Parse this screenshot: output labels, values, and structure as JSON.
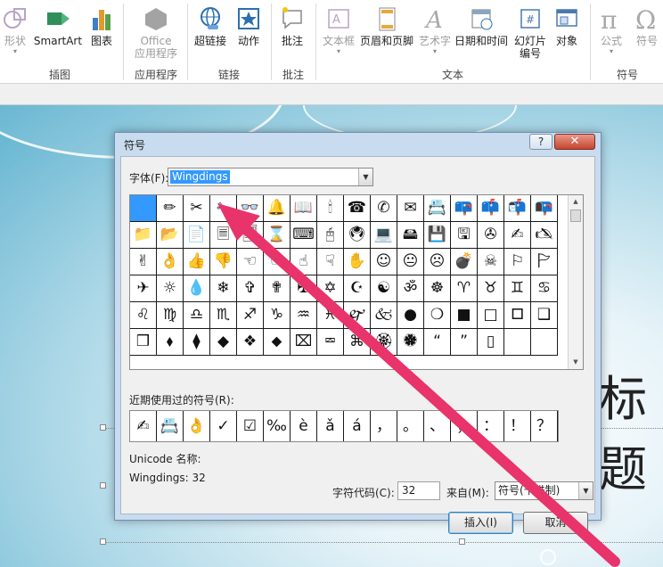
{
  "ribbon": {
    "buttons": [
      {
        "label": "形状",
        "icon": "shapes-icon",
        "disabled": true,
        "dropdown": true
      },
      {
        "label": "SmartArt",
        "icon": "smartart-icon",
        "disabled": false
      },
      {
        "label": "图表",
        "icon": "chart-icon",
        "disabled": false
      },
      {
        "label": "Office",
        "label2": "应用程序",
        "icon": "office-apps-icon",
        "disabled": true,
        "dropdown": true
      },
      {
        "label": "超链接",
        "icon": "hyperlink-icon",
        "disabled": false
      },
      {
        "label": "动作",
        "icon": "action-icon",
        "disabled": false
      },
      {
        "label": "批注",
        "icon": "comment-icon",
        "disabled": false
      },
      {
        "label": "文本框",
        "icon": "textbox-icon",
        "disabled": true,
        "dropdown": true
      },
      {
        "label": "页眉和页脚",
        "icon": "header-footer-icon",
        "disabled": false
      },
      {
        "label": "艺术字",
        "icon": "wordart-icon",
        "disabled": true,
        "dropdown": true
      },
      {
        "label": "日期和时间",
        "icon": "date-time-icon",
        "disabled": false
      },
      {
        "label": "幻灯片",
        "label2": "编号",
        "icon": "slide-number-icon",
        "disabled": false
      },
      {
        "label": "对象",
        "icon": "object-icon",
        "disabled": false
      },
      {
        "label": "公式",
        "icon": "equation-icon",
        "disabled": true,
        "dropdown": true
      },
      {
        "label": "符号",
        "icon": "symbol-icon",
        "disabled": true
      }
    ],
    "groups": [
      "插图",
      "应用程序",
      "链接",
      "批注",
      "文本",
      "符号"
    ]
  },
  "slide": {
    "title_fragment": "标题"
  },
  "dialog": {
    "title": "符号",
    "help": "?",
    "close": "✕",
    "font_label": "字体(F):",
    "font_value": "Wingdings",
    "symbols": [
      [
        "",
        "✏",
        "✂",
        "✁",
        "👓",
        "🔔",
        "📖",
        "🕯",
        "☎",
        "✆",
        "✉",
        "📇",
        "📪",
        "📫",
        "📬",
        "📭"
      ],
      [
        "📁",
        "📂",
        "📄",
        "🗏",
        "🗐",
        "⌛",
        "⌨",
        "🖰",
        "🖲",
        "💻",
        "🖴",
        "💾",
        "🖫",
        "✇",
        "✍",
        "🖎"
      ],
      [
        "✌",
        "👌",
        "👍",
        "👎",
        "☜",
        "☞",
        "☝",
        "☟",
        "✋",
        "☺",
        "😐",
        "☹",
        "💣",
        "☠",
        "⚐",
        "🏱"
      ],
      [
        "✈",
        "☼",
        "💧",
        "❄",
        "✞",
        "✟",
        "✠",
        "✡",
        "☪",
        "☯",
        "ॐ",
        "☸",
        "♈",
        "♉",
        "♊",
        "♋"
      ],
      [
        "♌",
        "♍",
        "♎",
        "♏",
        "♐",
        "♑",
        "♒",
        "♓",
        "🙰",
        "🙵",
        "●",
        "❍",
        "■",
        "□",
        "🞐",
        "❑"
      ],
      [
        "❒",
        "⬧",
        "⧫",
        "◆",
        "❖",
        "⬥",
        "⌧",
        "⮹",
        "⌘",
        "🏵",
        "🏶",
        "“",
        "”",
        "▯",
        "",
        ""
      ]
    ],
    "recent_label": "近期使用过的符号(R):",
    "recent": [
      "✍",
      "📇",
      "👌",
      "✓",
      "☑",
      "‰",
      "è",
      "ǎ",
      "á",
      "，",
      "。",
      "、",
      "；",
      "：",
      "！",
      "？"
    ],
    "unicode_name_label": "Unicode 名称:",
    "char_name": "Wingdings: 32",
    "char_code_label": "字符代码(C):",
    "char_code_value": "32",
    "from_label": "来自(M):",
    "from_value": "符号(十进制)",
    "insert_button": "插入(I)",
    "cancel_button": "取消"
  },
  "colors": {
    "selection": "#3399ff",
    "arrow": "#e8336b",
    "close_button": "#c6452f"
  }
}
